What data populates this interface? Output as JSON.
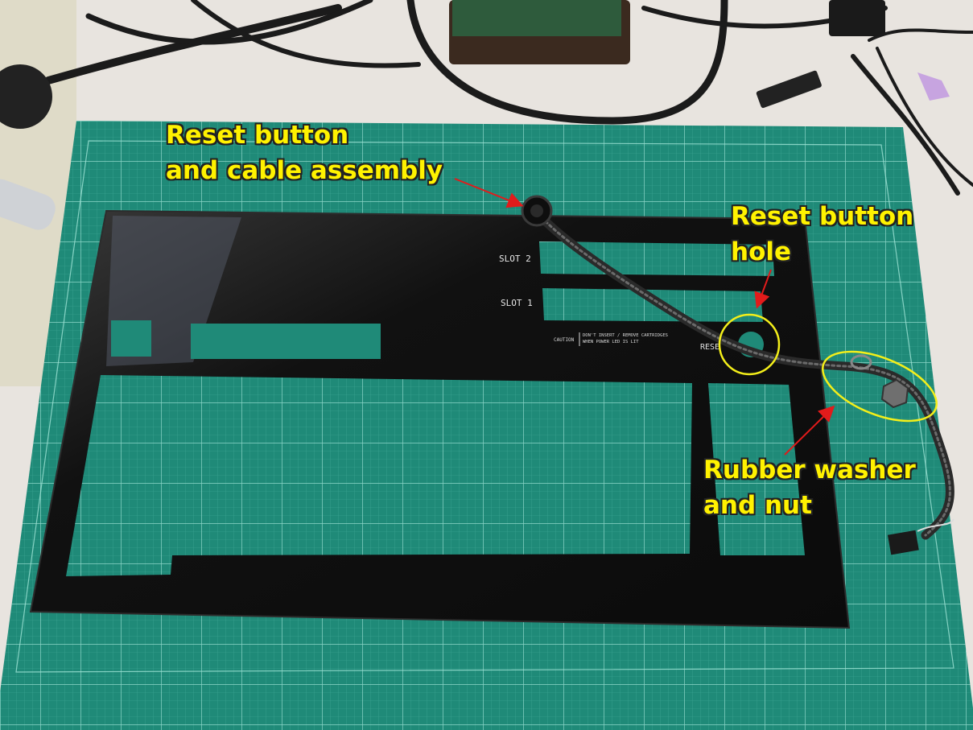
{
  "photo": {
    "callouts": {
      "reset_assembly": [
        "Reset button",
        "and cable assembly"
      ],
      "reset_hole": [
        "Reset button",
        "hole"
      ],
      "washer_nut": [
        "Rubber washer",
        "and nut"
      ]
    },
    "panel_labels": {
      "slot2": "SLOT 2",
      "slot1": "SLOT 1",
      "caution": "CAUTION",
      "caution_text_1": "DON'T INSERT / REMOVE CARTRIDGES",
      "caution_text_2": "WHEN POWER LED IS LIT",
      "reset": "RESE"
    },
    "colors": {
      "mat": "#1f8a78",
      "grid": "#7fd1c4",
      "panel": "#151515",
      "callout_text": "#fff200",
      "highlight": "#f4ef1a",
      "arrow": "#e21b1b"
    }
  }
}
